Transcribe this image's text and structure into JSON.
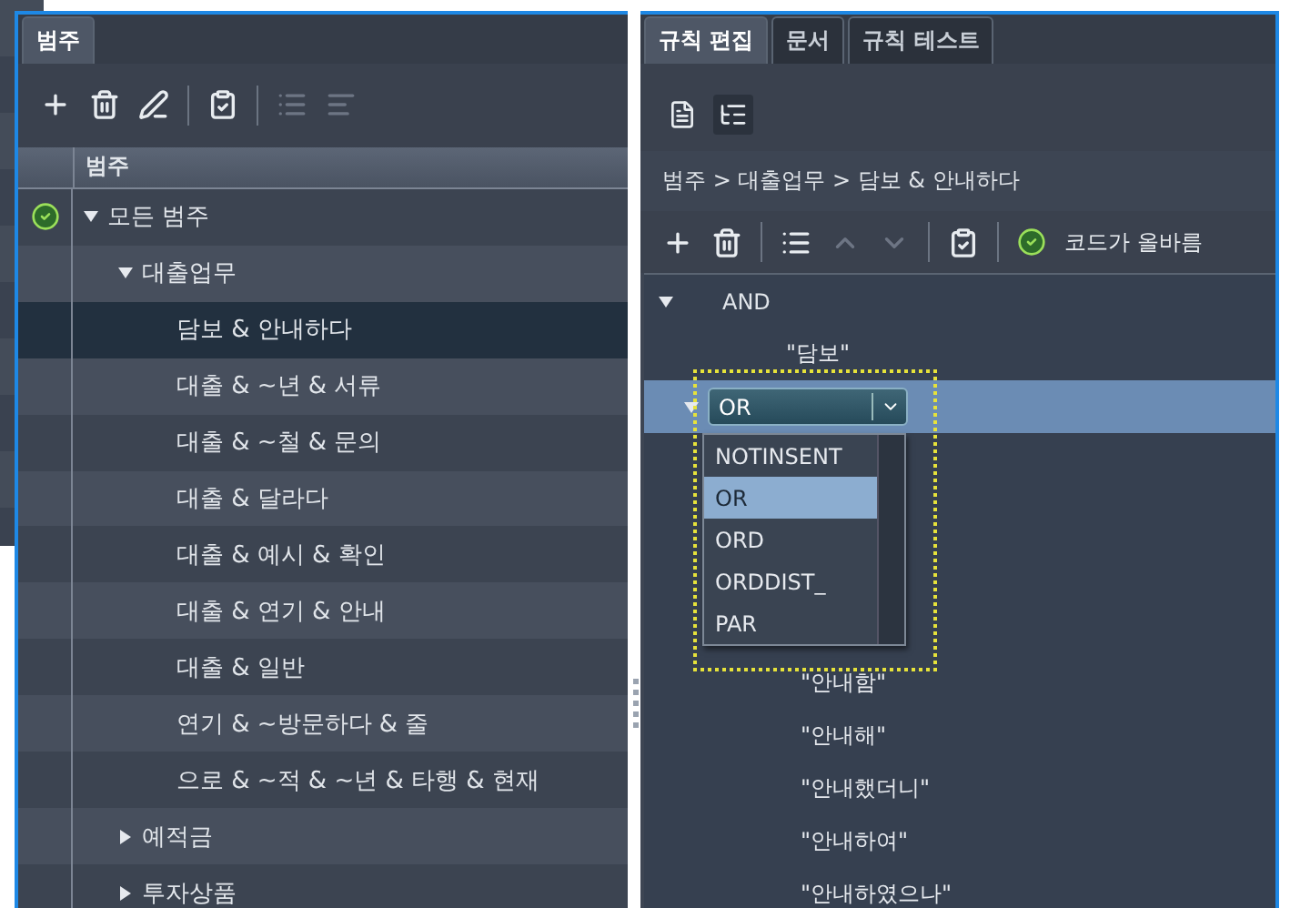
{
  "left_panel": {
    "tabs": [
      {
        "label": "범주",
        "selected": true
      }
    ],
    "toolbar": [
      {
        "kind": "add",
        "disabled": false
      },
      {
        "kind": "delete",
        "disabled": false
      },
      {
        "kind": "rename",
        "disabled": false
      },
      {
        "kind": "check",
        "disabled": false
      },
      {
        "kind": "list",
        "disabled": true
      },
      {
        "kind": "hierarchy",
        "disabled": true
      }
    ],
    "column_header": "범주",
    "tree": [
      {
        "label": "모든 범주",
        "valid": true,
        "expanded": true,
        "selected": false,
        "children": [
          {
            "label": "대출업무",
            "expanded": true,
            "selected": false,
            "children": [
              {
                "label": "담보 & 안내하다",
                "selected": true
              },
              {
                "label": "대출 & ~년 & 서류",
                "selected": false
              },
              {
                "label": "대출 & ~철 & 문의",
                "selected": false
              },
              {
                "label": "대출 & 달라다",
                "selected": false
              },
              {
                "label": "대출 & 예시 & 확인",
                "selected": false
              },
              {
                "label": "대출 & 연기 & 안내",
                "selected": false
              },
              {
                "label": "대출 & 일반",
                "selected": false
              },
              {
                "label": "연기 & ~방문하다 & 줄",
                "selected": false
              },
              {
                "label": "으로 & ~적 & ~년 & 타행 & 현재",
                "selected": false
              }
            ]
          },
          {
            "label": "예적금",
            "expanded": false,
            "selected": false
          },
          {
            "label": "투자상품",
            "expanded": false,
            "selected": false
          }
        ]
      }
    ]
  },
  "right_panel": {
    "tabs": [
      {
        "label": "규칙 편집",
        "selected": true
      },
      {
        "label": "문서",
        "selected": false
      },
      {
        "label": "규칙 테스트",
        "selected": false
      }
    ],
    "view_buttons": [
      {
        "kind": "document",
        "selected": false
      },
      {
        "kind": "tree",
        "selected": true
      }
    ],
    "breadcrumb": "범주 > 대출업무 > 담보 & 안내하다",
    "toolbar": [
      {
        "kind": "add",
        "disabled": false
      },
      {
        "kind": "delete",
        "disabled": false
      },
      {
        "kind": "list",
        "disabled": false
      },
      {
        "kind": "up",
        "disabled": true
      },
      {
        "kind": "down",
        "disabled": true
      },
      {
        "kind": "check",
        "disabled": false
      }
    ],
    "status": "코드가 올바름",
    "rule_rows": [
      {
        "kind": "operator",
        "label": "AND",
        "expanded": true,
        "selected": false
      },
      {
        "kind": "term",
        "text": "\"담보\""
      },
      {
        "kind": "select",
        "value": "OR",
        "expanded": true,
        "selected": true,
        "options": [
          {
            "label": "NOTINSENT",
            "selected": false
          },
          {
            "label": "OR",
            "selected": true
          },
          {
            "label": "ORD",
            "selected": false
          },
          {
            "label": "ORDDIST_",
            "selected": false
          },
          {
            "label": "PAR",
            "selected": false
          }
        ]
      },
      {
        "kind": "term",
        "text": "\"안내함\""
      },
      {
        "kind": "term",
        "text": "\"안내해\""
      },
      {
        "kind": "term",
        "text": "\"안내했더니\""
      },
      {
        "kind": "term",
        "text": "\"안내하여\""
      },
      {
        "kind": "term",
        "text": "\"안내하였으나\""
      }
    ]
  }
}
